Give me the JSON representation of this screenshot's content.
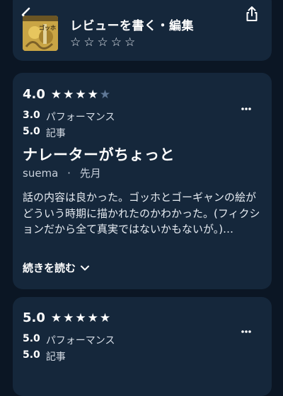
{
  "header": {
    "write_review_label": "レビューを書く・編集",
    "cover_text": "ゴッホ"
  },
  "review1": {
    "rating": "4.0",
    "stars_filled": 4,
    "performance_score": "3.0",
    "performance_label": "パフォーマンス",
    "story_score": "5.0",
    "story_label": "記事",
    "title": "ナレーターがちょっと",
    "author": "suema",
    "separator": "·",
    "date": "先月",
    "body": "話の内容は良かった。ゴッホとゴーギャンの絵がどういう時期に描かれたのかわかった。(フィクションだから全て真実ではないかもないが。)…",
    "read_more_label": "続きを読む"
  },
  "review2": {
    "rating": "5.0",
    "stars_filled": 5,
    "performance_score": "5.0",
    "performance_label": "パフォーマンス",
    "story_score": "5.0",
    "story_label": "記事"
  },
  "colors": {
    "background": "#0b1624",
    "card": "#15273b",
    "star_empty": "#5f7897"
  }
}
